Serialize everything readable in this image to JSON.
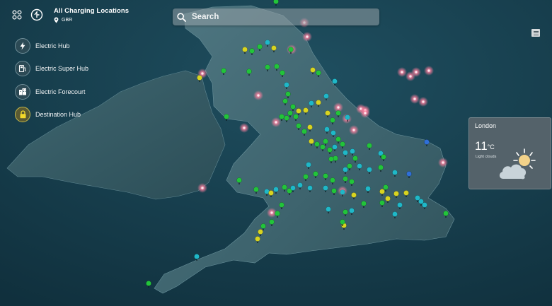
{
  "header": {
    "title": "All Charging Locations",
    "country": "GBR"
  },
  "search": {
    "placeholder": "Search"
  },
  "legend": [
    {
      "label": "Electric Hub",
      "icon": "lightning-icon"
    },
    {
      "label": "Electric Super Hub",
      "icon": "charger-icon"
    },
    {
      "label": "Electric Forecourt",
      "icon": "building-icon"
    },
    {
      "label": "Destination Hub",
      "icon": "lock-icon"
    }
  ],
  "weather": {
    "city": "London",
    "temperature": "11",
    "unit": "°C",
    "condition": "Light clouds",
    "icon": "partly-cloudy-icon"
  },
  "colors": {
    "sea": "#173d4d",
    "land": "#3f6570",
    "pin_green": "#22c43a",
    "pin_teal": "#1fb8c8",
    "pin_yellow": "#d8d420",
    "pin_blue": "#2f6fd8",
    "glow_pink": "#ff8fa8"
  }
}
